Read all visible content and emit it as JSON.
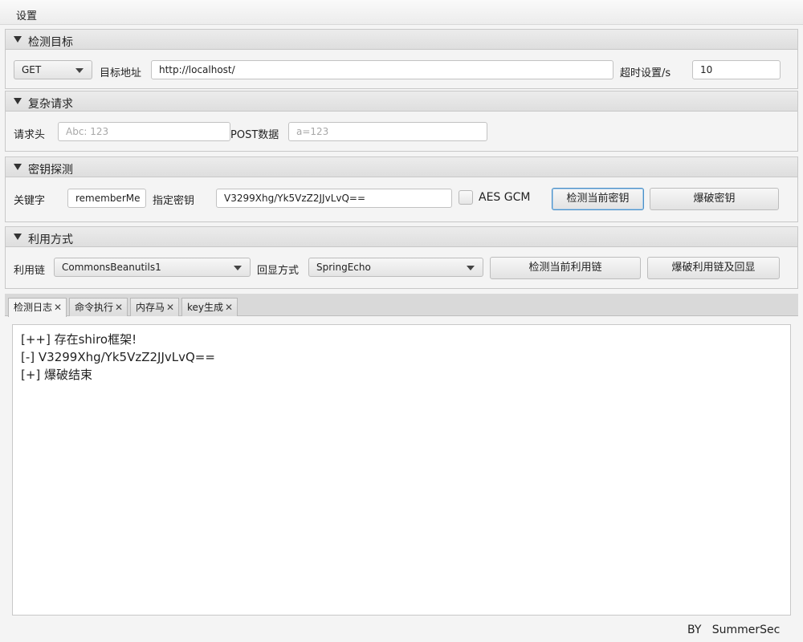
{
  "menu": {
    "settings": "设置"
  },
  "target_panel": {
    "title": "检测目标",
    "method": "GET",
    "url_label": "目标地址",
    "url_value": "http://localhost/",
    "timeout_label": "超时设置/s",
    "timeout_value": "10"
  },
  "complex_panel": {
    "title": "复杂请求",
    "header_label": "请求头",
    "header_placeholder": "Abc: 123",
    "post_label": "POST数据",
    "post_placeholder": "a=123"
  },
  "key_panel": {
    "title": "密钥探测",
    "keyword_label": "关键字",
    "keyword_value": "rememberMe",
    "key_label": "指定密钥",
    "key_value": "V3299Xhg/Yk5VzZ2JJvLvQ==",
    "aes_gcm_label": "AES GCM",
    "check_key_button": "检测当前密钥",
    "brute_key_button": "爆破密钥"
  },
  "exploit_panel": {
    "title": "利用方式",
    "chain_label": "利用链",
    "chain_value": "CommonsBeanutils1",
    "echo_label": "回显方式",
    "echo_value": "SpringEcho",
    "check_chain_button": "检测当前利用链",
    "brute_chain_button": "爆破利用链及回显"
  },
  "tabs": [
    {
      "label": "检测日志"
    },
    {
      "label": "命令执行"
    },
    {
      "label": "内存马"
    },
    {
      "label": "key生成"
    }
  ],
  "tab_close_glyph": "✕",
  "log": [
    "[++] 存在shiro框架!",
    "[-] V3299Xhg/Yk5VzZ2JJvLvQ==",
    "[+] 爆破结束"
  ],
  "footer": "BY   SummerSec"
}
